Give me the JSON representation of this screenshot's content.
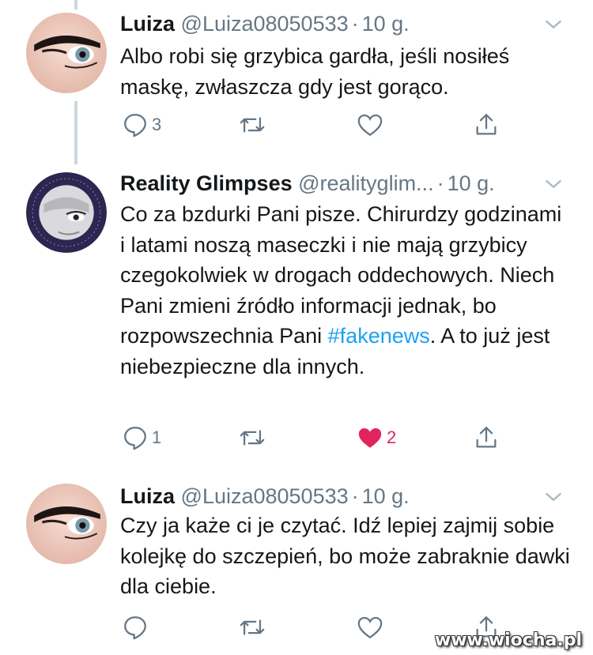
{
  "tweets": [
    {
      "name": "Luiza",
      "handle": "@Luiza08050533",
      "time": "10 g.",
      "text": "Albo robi się grzybica gardła, jeśli nosiłeś maskę, zwłaszcza gdy jest gorąco.",
      "reply_count": "3",
      "retweet_count": "",
      "like_count": "",
      "liked": false
    },
    {
      "name": "Reality Glimpses",
      "handle": "@realityglim...",
      "time": "10 g.",
      "text_before": "Co za bzdurki Pani pisze. Chirurdzy godzinami i latami noszą maseczki i nie mają grzybicy czegokolwiek w drogach oddechowych.  Niech Pani zmieni źródło informacji jednak, bo rozpowszechnia Pani ",
      "hashtag": "#fakenews",
      "text_after": ". A to już jest niebezpieczne dla innych.",
      "reply_count": "1",
      "retweet_count": "",
      "like_count": "2",
      "liked": true
    },
    {
      "name": "Luiza",
      "handle": "@Luiza08050533",
      "time": "10 g.",
      "text": "Czy ja każe ci je czytać. Idź lepiej zajmij sobie kolejkę do szczepień, bo może zabraknie dawki dla ciebie.",
      "reply_count": "",
      "retweet_count": "",
      "like_count": "",
      "liked": false
    }
  ],
  "icons": {
    "reply": "reply-icon",
    "retweet": "retweet-icon",
    "like": "heart-icon",
    "share": "share-icon",
    "menu": "chevron-down-icon"
  },
  "colors": {
    "text": "#14171a",
    "muted": "#657786",
    "link": "#1da1f2",
    "like": "#e0245e",
    "thread": "#ccd6dd"
  },
  "watermark": "www.wiocha.pl"
}
